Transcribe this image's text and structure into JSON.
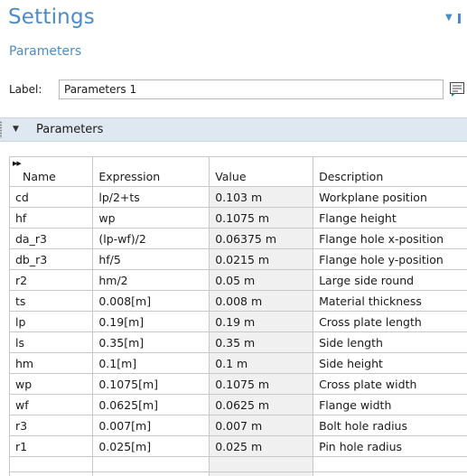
{
  "panel": {
    "title": "Settings",
    "subtitle": "Parameters",
    "label_caption": "Label:",
    "label_value": "Parameters 1"
  },
  "section": {
    "title": "Parameters"
  },
  "table": {
    "columns": [
      "Name",
      "Expression",
      "Value",
      "Description"
    ],
    "rows": [
      [
        "cd",
        "lp/2+ts",
        "0.103 m",
        "Workplane position"
      ],
      [
        "hf",
        "wp",
        "0.1075 m",
        "Flange height"
      ],
      [
        "da_r3",
        "(lp-wf)/2",
        "0.06375 m",
        "Flange hole x-position"
      ],
      [
        "db_r3",
        "hf/5",
        "0.0215 m",
        "Flange hole y-position"
      ],
      [
        "r2",
        "hm/2",
        "0.05 m",
        "Large side round"
      ],
      [
        "ts",
        "0.008[m]",
        "0.008 m",
        "Material thickness"
      ],
      [
        "lp",
        "0.19[m]",
        "0.19 m",
        "Cross plate length"
      ],
      [
        "ls",
        "0.35[m]",
        "0.35 m",
        "Side length"
      ],
      [
        "hm",
        "0.1[m]",
        "0.1 m",
        "Side height"
      ],
      [
        "wp",
        "0.1075[m]",
        "0.1075 m",
        "Cross plate width"
      ],
      [
        "wf",
        "0.0625[m]",
        "0.0625 m",
        "Flange width"
      ],
      [
        "r3",
        "0.007[m]",
        "0.007 m",
        "Bolt hole radius"
      ],
      [
        "r1",
        "0.025[m]",
        "0.025 m",
        "Pin hole radius"
      ]
    ]
  },
  "colors": {
    "accent": "#4c8bc6",
    "section_bg": "#dfe7f1",
    "value_col_bg": "#f0f0f0"
  },
  "icons": {
    "pin": "pin-icon",
    "collapse": "caret-down-icon",
    "note": "comment-icon"
  }
}
